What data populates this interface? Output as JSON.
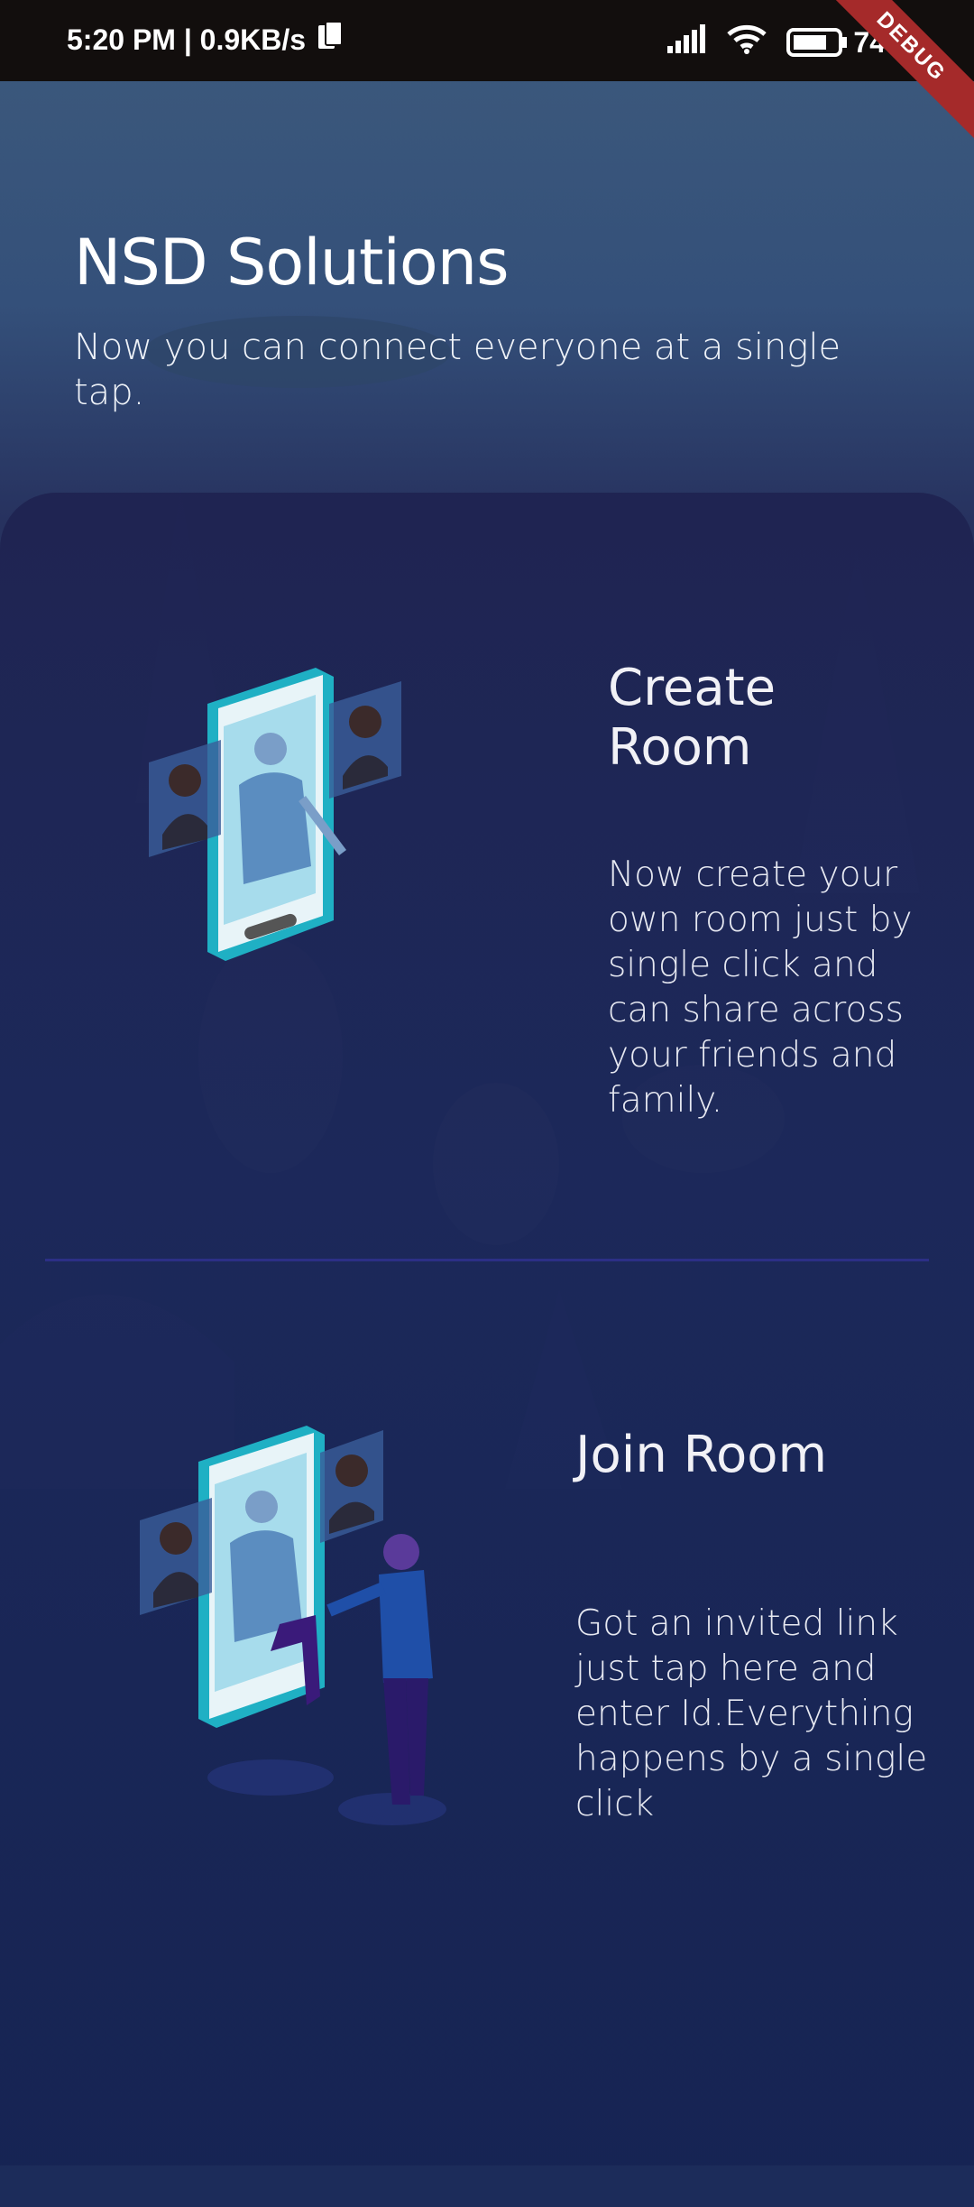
{
  "status_bar": {
    "time_speed": "5:20 PM | 0.9KB/s",
    "battery": "74",
    "debug_label": "DEBUG"
  },
  "header": {
    "title": "NSD Solutions",
    "subtitle": "Now you can connect everyone at a single tap."
  },
  "options": [
    {
      "title_line1": "Create",
      "title_line2": "Room",
      "description": "Now create your own room just by single click and can share across your friends and family."
    },
    {
      "title_line1": "Join Room",
      "description": "Got an invited link just tap here and enter Id.Everything happens by a single click"
    }
  ],
  "colors": {
    "statusbar": "#120e0d",
    "panel": "#1c2a5a",
    "accent_teal": "#1fb0c4",
    "divider": "#2c2f86"
  }
}
